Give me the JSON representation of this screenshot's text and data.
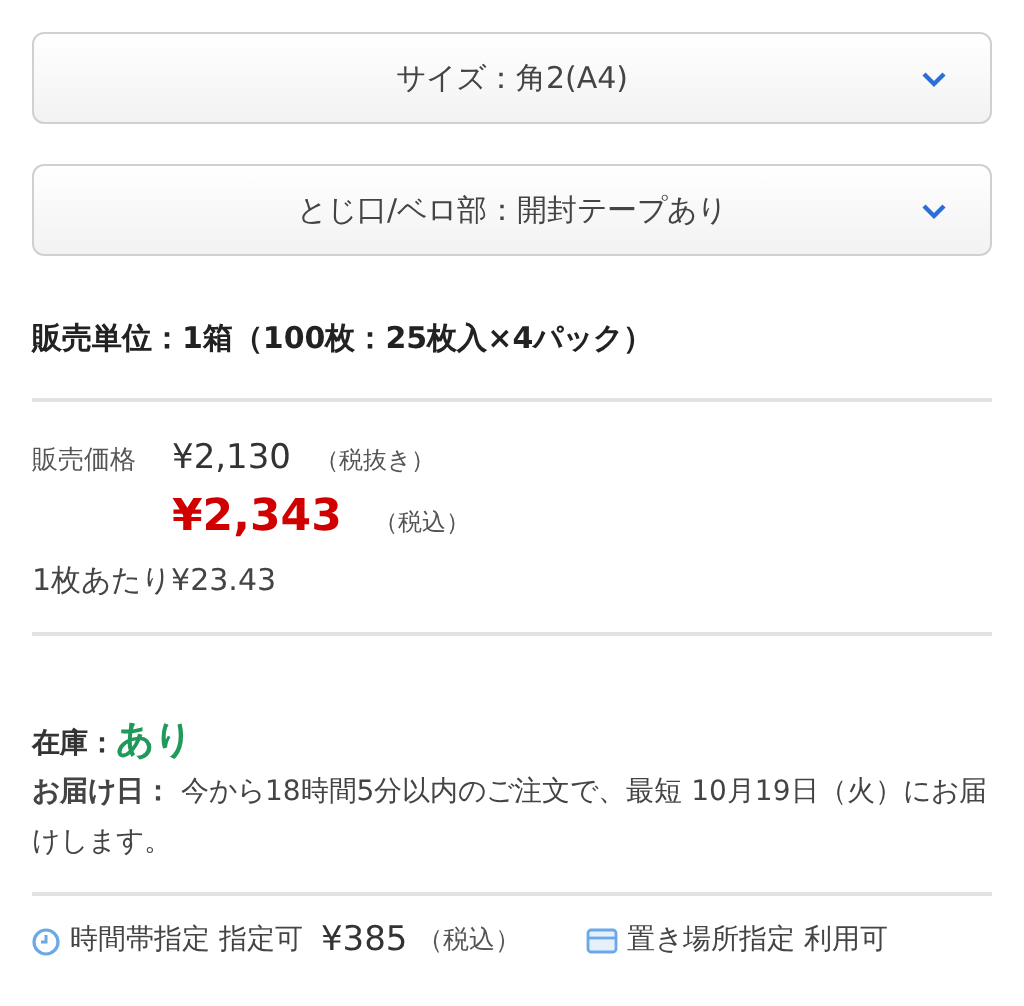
{
  "selects": [
    {
      "label": "サイズ：角2(A4)"
    },
    {
      "label": "とじ口/ベロ部：開封テープあり"
    }
  ],
  "sale_unit": "販売単位：1箱（100枚：25枚入×4パック）",
  "price": {
    "label": "販売価格",
    "price_ex_tax": "¥2,130",
    "ex_tax_note": "（税抜き）",
    "price_in_tax": "¥2,343",
    "in_tax_note": "（税込）",
    "per_sheet": "1枚あたり¥23.43"
  },
  "stock": {
    "label": "在庫：",
    "value": "あり"
  },
  "delivery": "**お届け日：** 今から18時間5分以内のご注文で、最短 10月19日（火）にお届けします。",
  "options": [
    {
      "kind": "time",
      "label": "時間帯指定 指定可",
      "price": "¥385",
      "note": "（税込）"
    },
    {
      "kind": "place",
      "label": "置き場所指定 利用可"
    }
  ]
}
